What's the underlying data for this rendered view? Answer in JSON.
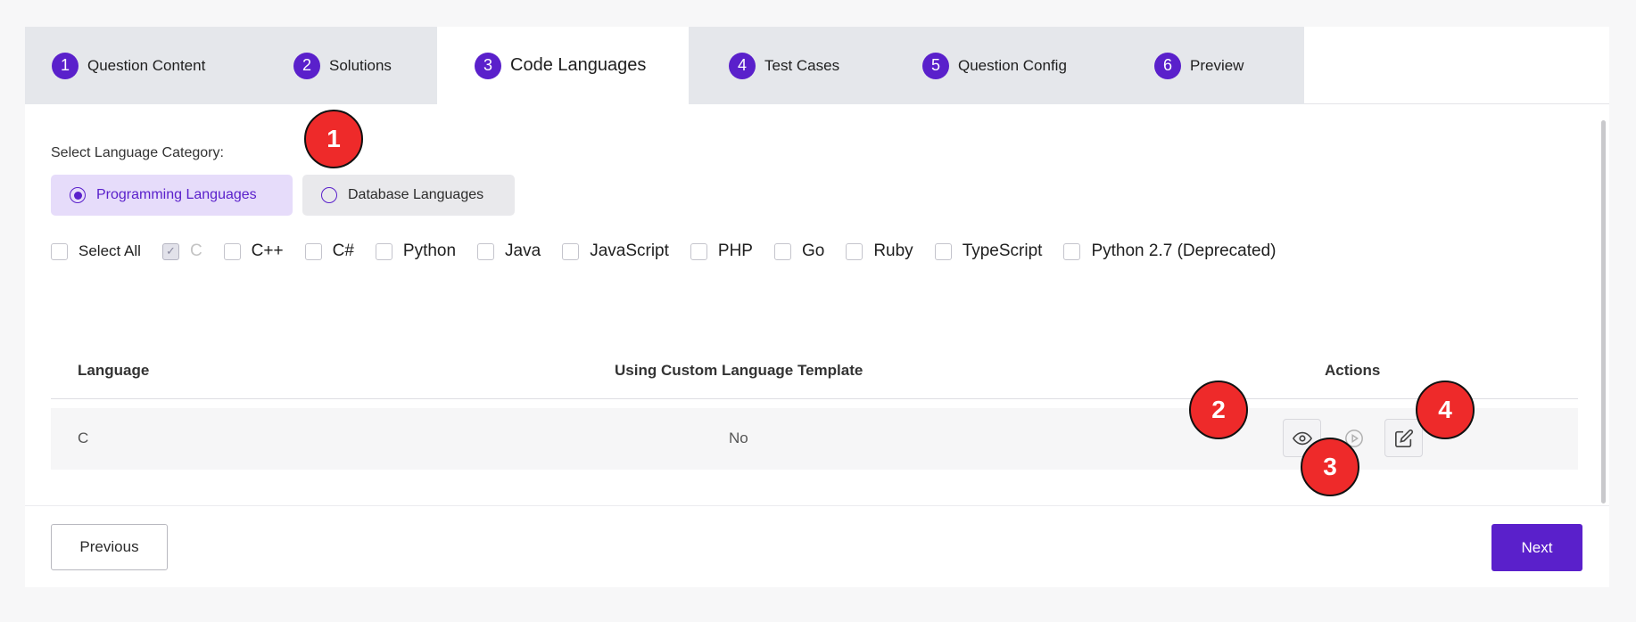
{
  "stepper": {
    "steps": [
      {
        "num": "1",
        "label": "Question Content"
      },
      {
        "num": "2",
        "label": "Solutions"
      },
      {
        "num": "3",
        "label": "Code Languages"
      },
      {
        "num": "4",
        "label": "Test Cases"
      },
      {
        "num": "5",
        "label": "Question Config"
      },
      {
        "num": "6",
        "label": "Preview"
      }
    ],
    "active_step": "3"
  },
  "category": {
    "label": "Select Language Category:",
    "options": [
      {
        "label": "Programming Languages",
        "selected": true
      },
      {
        "label": "Database Languages",
        "selected": false
      }
    ]
  },
  "languages": [
    {
      "label": "Select All",
      "checked": false,
      "disabled": false
    },
    {
      "label": "C",
      "checked": true,
      "disabled": true
    },
    {
      "label": "C++",
      "checked": false,
      "disabled": false
    },
    {
      "label": "C#",
      "checked": false,
      "disabled": false
    },
    {
      "label": "Python",
      "checked": false,
      "disabled": false
    },
    {
      "label": "Java",
      "checked": false,
      "disabled": false
    },
    {
      "label": "JavaScript",
      "checked": false,
      "disabled": false
    },
    {
      "label": "PHP",
      "checked": false,
      "disabled": false
    },
    {
      "label": "Go",
      "checked": false,
      "disabled": false
    },
    {
      "label": "Ruby",
      "checked": false,
      "disabled": false
    },
    {
      "label": "TypeScript",
      "checked": false,
      "disabled": false
    },
    {
      "label": "Python 2.7 (Deprecated)",
      "checked": false,
      "disabled": false
    }
  ],
  "table": {
    "headers": {
      "language": "Language",
      "custom": "Using Custom Language Template",
      "actions": "Actions"
    },
    "rows": [
      {
        "language": "C",
        "custom": "No"
      }
    ],
    "action_icons": [
      "eye-icon",
      "play-circle-icon",
      "edit-icon"
    ]
  },
  "footer": {
    "previous": "Previous",
    "next": "Next"
  },
  "markers": [
    "1",
    "2",
    "3",
    "4"
  ],
  "colors": {
    "accent": "#5a20cb",
    "marker": "#ee2a2a",
    "step_bg": "#e5e7eb"
  }
}
